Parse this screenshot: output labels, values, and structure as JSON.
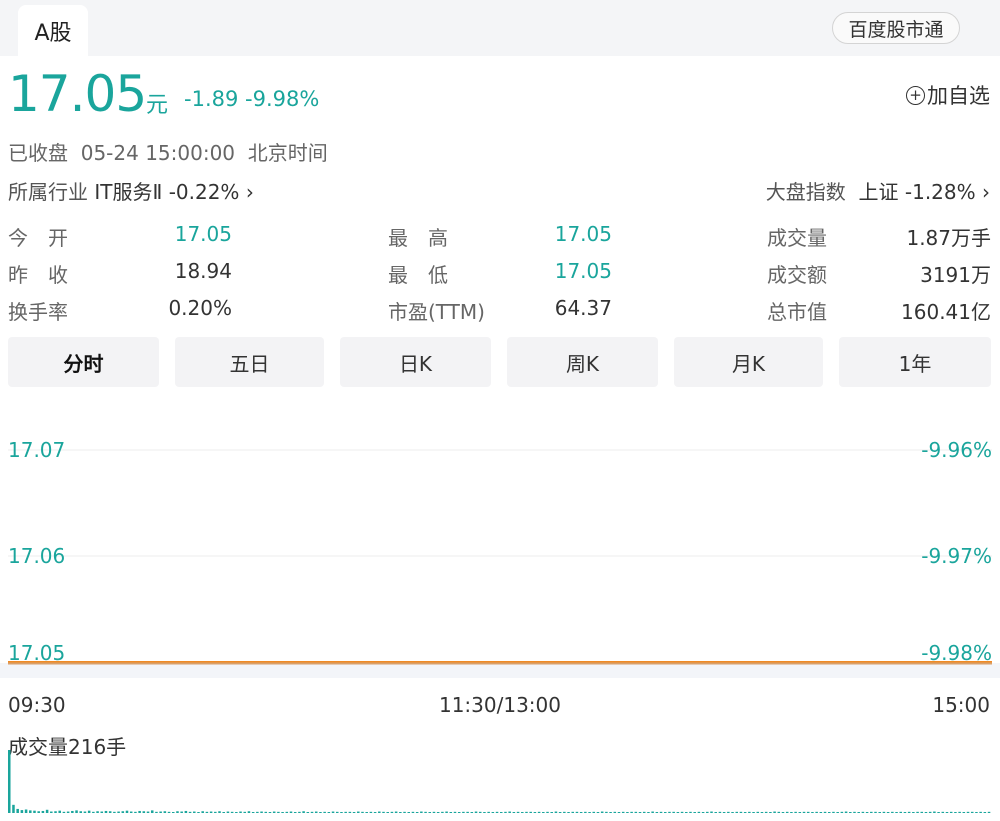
{
  "header": {
    "market_tab": "A股",
    "brand_button": "百度股市通"
  },
  "quote": {
    "price": "17.05",
    "unit": "元",
    "change": "-1.89",
    "change_pct": "-9.98%",
    "add_watch": "加自选"
  },
  "status": {
    "state": "已收盘",
    "datetime": "05-24 15:00:00",
    "timezone": "北京时间"
  },
  "industry": {
    "label": "所属行业",
    "name": "IT服务Ⅱ",
    "change": "-0.22%"
  },
  "index": {
    "label": "大盘指数",
    "name": "上证",
    "change": "-1.28%"
  },
  "stats": {
    "open": {
      "label": "今　开",
      "value": "17.05"
    },
    "prev_close": {
      "label": "昨　收",
      "value": "18.94"
    },
    "turnover_rate": {
      "label": "换手率",
      "value": "0.20%"
    },
    "high": {
      "label": "最　高",
      "value": "17.05"
    },
    "low": {
      "label": "最　低",
      "value": "17.05"
    },
    "pe_ttm": {
      "label": "市盈(TTM)",
      "value": "64.37"
    },
    "volume": {
      "label": "成交量",
      "value": "1.87万手"
    },
    "amount": {
      "label": "成交额",
      "value": "3191万"
    },
    "market_cap": {
      "label": "总市值",
      "value": "160.41亿"
    }
  },
  "periods": [
    "分时",
    "五日",
    "日K",
    "周K",
    "月K",
    "1年"
  ],
  "active_period": 0,
  "colors": {
    "green": "#1aa59c",
    "price_line": "#f08a24",
    "grid": "#eeeeee"
  },
  "chart_data": {
    "type": "line",
    "price": {
      "y_ticks": [
        "17.07",
        "17.06",
        "17.05"
      ],
      "y_tick_values": [
        17.07,
        17.06,
        17.05
      ],
      "pct_ticks": [
        "-9.96%",
        "-9.97%",
        "-9.98%"
      ],
      "ylim": [
        17.05,
        17.07
      ],
      "series": [
        {
          "values": [
            17.05,
            17.05,
            17.05,
            17.05,
            17.05,
            17.05,
            17.05,
            17.05,
            17.05,
            17.05,
            17.05,
            17.05,
            17.05,
            17.05,
            17.05,
            17.05,
            17.05,
            17.05,
            17.05,
            17.05,
            17.05,
            17.05,
            17.05,
            17.05,
            17.05
          ]
        },
        {
          "values": [
            17.05,
            17.05,
            17.05,
            17.05,
            17.05,
            17.05,
            17.05,
            17.05,
            17.05,
            17.05,
            17.05,
            17.05,
            17.05,
            17.05,
            17.05,
            17.05,
            17.05,
            17.05,
            17.05,
            17.05,
            17.05,
            17.05,
            17.05,
            17.05,
            17.05
          ]
        }
      ]
    },
    "time_labels": [
      "09:30",
      "11:30/13:00",
      "15:00"
    ],
    "volume": {
      "label": "成交量216手",
      "values": [
        216,
        28,
        14,
        10,
        12,
        9,
        8,
        6,
        7,
        11,
        5,
        6,
        8,
        4,
        5,
        7,
        9,
        6,
        5,
        8,
        4,
        6,
        5,
        7,
        6,
        4,
        5,
        6,
        8,
        5,
        4,
        7,
        6,
        5,
        9,
        4,
        5,
        6,
        4,
        3,
        6,
        5,
        7,
        4,
        5,
        3,
        6,
        4,
        5,
        4,
        6,
        3,
        5,
        4,
        3,
        5,
        4,
        6,
        3,
        4,
        5,
        4,
        3,
        5,
        4,
        3,
        4,
        5,
        3,
        4,
        6,
        3,
        4,
        5,
        3,
        4,
        3,
        5,
        4,
        3,
        4,
        4,
        3,
        5,
        4,
        3,
        4,
        3,
        5,
        4,
        3,
        4,
        5,
        3,
        4,
        3,
        4,
        3,
        5,
        4,
        3,
        4,
        3,
        4,
        5,
        3,
        4,
        3,
        4,
        4,
        3,
        5,
        4,
        3,
        4,
        3,
        4,
        3,
        4,
        5,
        3,
        4,
        3,
        4,
        4,
        3,
        4,
        3,
        4,
        3,
        5,
        3,
        4,
        3,
        4,
        4,
        3,
        4,
        3,
        4,
        3,
        5,
        4,
        3,
        4,
        3,
        4,
        3,
        4,
        4,
        3,
        4,
        3,
        5,
        3,
        4,
        3,
        4,
        4,
        3,
        4,
        3,
        4,
        3,
        4,
        3,
        4,
        5,
        3,
        4,
        3,
        4,
        3,
        4,
        4,
        3,
        4,
        3,
        4,
        3,
        4,
        3,
        5,
        4,
        3,
        4,
        3,
        4,
        3,
        4,
        4,
        3,
        4,
        3,
        4,
        3,
        4,
        3,
        4,
        5,
        3,
        4,
        3,
        4,
        3,
        4,
        4,
        3,
        4,
        3,
        4,
        3,
        4,
        3,
        4,
        3,
        4,
        4,
        3,
        4,
        5,
        3,
        4,
        3,
        4,
        3,
        4,
        3,
        4,
        4,
        3,
        4,
        3,
        4
      ]
    }
  }
}
